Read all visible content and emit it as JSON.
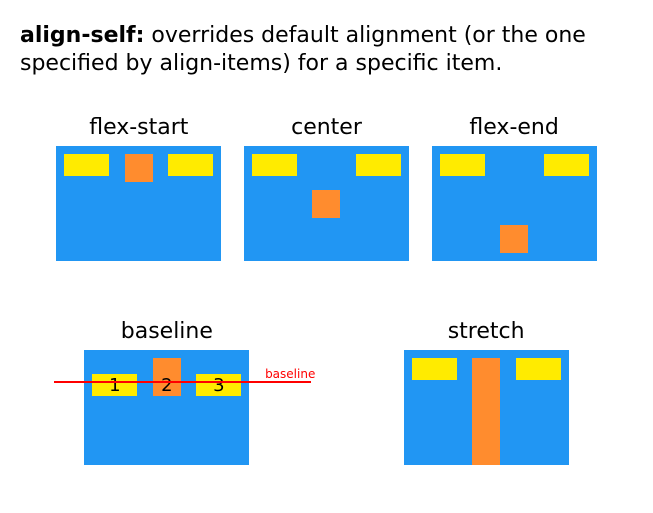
{
  "headline": {
    "property": "align-self:",
    "description": " overrides default alignment (or the one specified by align-items) for a specific item."
  },
  "colors": {
    "container": "#2196f3",
    "item": "#ffeb00",
    "item_highlight": "#ff8c2e",
    "baseline_line": "#ff0000"
  },
  "examples": {
    "flex_start": {
      "title": "flex-start"
    },
    "center": {
      "title": "center"
    },
    "flex_end": {
      "title": "flex-end"
    },
    "baseline": {
      "title": "baseline",
      "baseline_label": "baseline",
      "labels": {
        "a": "1",
        "b": "2",
        "c": "3"
      }
    },
    "stretch": {
      "title": "stretch"
    }
  }
}
